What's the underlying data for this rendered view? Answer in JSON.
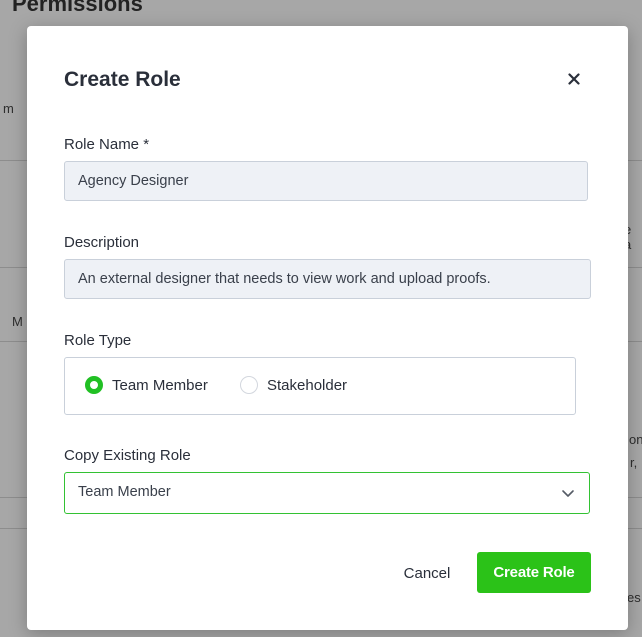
{
  "background": {
    "title": "Permissions",
    "fragments": [
      "m",
      "e a",
      "M",
      "on",
      "r,",
      "es"
    ]
  },
  "modal": {
    "title": "Create Role",
    "close_icon": "close-icon",
    "role_name": {
      "label": "Role Name *",
      "value": "Agency Designer"
    },
    "description": {
      "label": "Description",
      "value": "An external designer that needs to view work and upload proofs."
    },
    "role_type": {
      "label": "Role Type",
      "options": [
        {
          "label": "Team Member",
          "selected": true
        },
        {
          "label": "Stakeholder",
          "selected": false
        }
      ]
    },
    "copy_existing_role": {
      "label": "Copy Existing Role",
      "value": "Team Member",
      "icon": "chevron-down-icon"
    },
    "actions": {
      "cancel_label": "Cancel",
      "submit_label": "Create Role"
    }
  },
  "colors": {
    "accent_green": "#2bc218",
    "input_bg": "#eef1f6",
    "overlay": "rgba(0,0,0,0.32)"
  }
}
